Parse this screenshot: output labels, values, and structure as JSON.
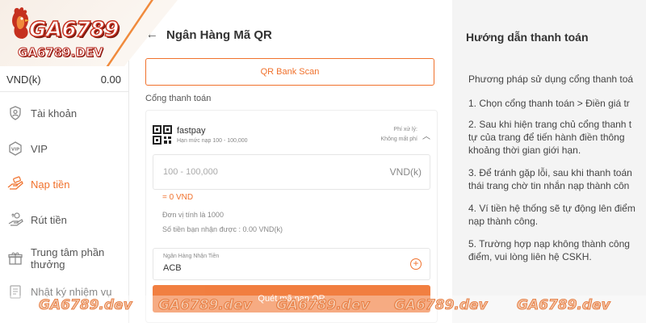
{
  "brand": {
    "logo_text": "GA6789",
    "logo_sub": "GA6789.DEV"
  },
  "balance": {
    "currency": "VND(k)",
    "amount": "0.00"
  },
  "sidebar": {
    "items": [
      {
        "label": "Tài khoản",
        "icon": "user-shield-icon"
      },
      {
        "label": "VIP",
        "icon": "vip-badge-icon"
      },
      {
        "label": "Nạp tiền",
        "icon": "deposit-hand-icon",
        "active": true
      },
      {
        "label": "Rút tiền",
        "icon": "withdraw-icon"
      },
      {
        "label": "Trung tâm phần thưởng",
        "icon": "gift-icon"
      },
      {
        "label": "Nhật ký nhiệm vụ",
        "icon": "task-log-icon"
      }
    ]
  },
  "main": {
    "title": "Ngân Hàng Mã QR",
    "qr_scan_label": "QR Bank Scan",
    "section_label": "Cổng thanh toán",
    "gateway": {
      "name": "fastpay",
      "limit": "Hạn mức nạp 100 - 100,000",
      "fee_label": "Phí xử lý:",
      "fee_value": "Không mất phí"
    },
    "amount": {
      "placeholder": "100 - 100,000",
      "unit": "VND(k)"
    },
    "equals_text": "= 0 VND",
    "unit_info": "Đơn vị tính là 1000",
    "receive_info": "Số tiền bạn nhận được : 0.00 VND(k)",
    "bank_field": {
      "label": "Ngân Hàng Nhận Tiền",
      "value": "ACB"
    },
    "submit_label": "Quét mã nạp QR"
  },
  "guide": {
    "title": "Hướng dẫn thanh toán",
    "lines": [
      "Phương pháp sử dụng cổng thanh toá",
      "1. Chọn cổng thanh toán > Điền giá tr",
      "2. Sau khi hiện trang chủ cổng thanh t",
      "tự của trang để tiến hành điền thông",
      "khoảng thời gian giới hạn.",
      "3. Để tránh gặp lỗi, sau khi thanh toán",
      "thái trang chờ tin nhắn nạp thành côn",
      "4. Ví tiền hệ thống sẽ tự động lên điểm",
      "nạp thành công.",
      "5. Trường hợp nạp không thành công",
      "điểm, vui lòng liên hệ CSKH."
    ]
  },
  "watermark": {
    "items": [
      "GA6789.dev",
      "GA6789.dev",
      "GA6789.dev",
      "GA6789.dev",
      "GA6789.dev"
    ]
  },
  "colors": {
    "accent": "#f0712c",
    "logo_red": "#c5301f"
  }
}
